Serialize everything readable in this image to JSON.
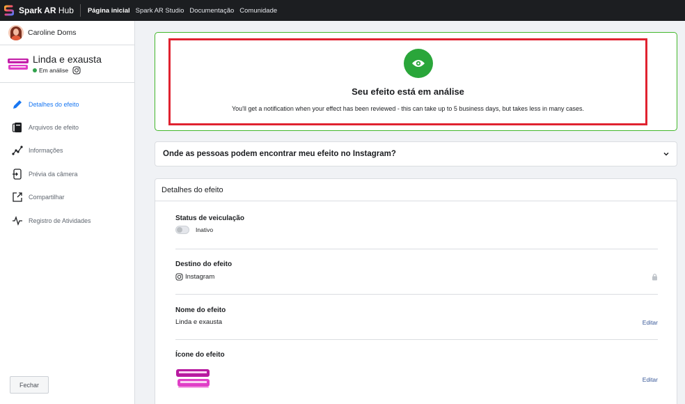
{
  "topbar": {
    "brand_bold": "Spark AR",
    "brand_light": " Hub",
    "nav": [
      {
        "label": "Página inicial",
        "active": true
      },
      {
        "label": "Spark AR Studio"
      },
      {
        "label": "Documentação"
      },
      {
        "label": "Comunidade"
      }
    ]
  },
  "sidebar": {
    "user_name": "Caroline Doms",
    "effect": {
      "title": "Linda e exausta",
      "status": "Em análise",
      "thumb_text": "LINDA E EXAUSTA"
    },
    "nav": [
      {
        "label": "Detalhes do efeito",
        "icon": "pencil-icon",
        "active": true
      },
      {
        "label": "Arquivos de efeito",
        "icon": "files-icon"
      },
      {
        "label": "Informações",
        "icon": "insights-icon"
      },
      {
        "label": "Prévia da câmera",
        "icon": "camera-preview-icon"
      },
      {
        "label": "Compartilhar",
        "icon": "share-icon"
      },
      {
        "label": "Registro de Atividades",
        "icon": "activity-icon"
      }
    ],
    "close_label": "Fechar"
  },
  "review": {
    "title": "Seu efeito está em análise",
    "description": "You'll get a notification when your effect has been reviewed - this can take up to 5 business days, but takes less in many cases."
  },
  "faq": {
    "question": "Onde as pessoas podem encontrar meu efeito no Instagram?"
  },
  "details": {
    "header": "Detalhes do efeito",
    "status_label": "Status de veiculação",
    "status_value": "Inativo",
    "destination_label": "Destino do efeito",
    "destination_value": "Instagram",
    "name_label": "Nome do efeito",
    "name_value": "Linda e exausta",
    "icon_label": "Ícone do efeito",
    "edit_label": "Editar"
  },
  "colors": {
    "accent": "#1877f2",
    "success": "#2aa63a",
    "highlight": "#e02230"
  }
}
